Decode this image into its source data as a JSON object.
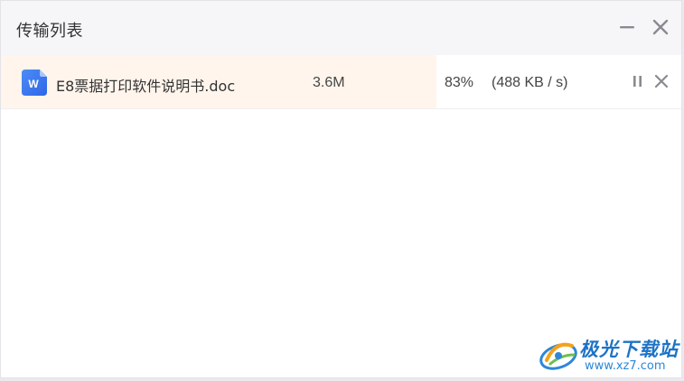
{
  "window": {
    "title": "传输列表"
  },
  "transfers": [
    {
      "icon": "wps-word-document-icon",
      "icon_letter": "W",
      "file_name": "E8票据打印软件说明书.doc",
      "size": "3.6M",
      "percent_label": "83%",
      "progress": 0.64,
      "speed": "(488 KB / s)"
    }
  ],
  "watermark": {
    "name": "极光下载站",
    "url": "www.xz7.com"
  },
  "colors": {
    "titlebar_bg": "#f6f6f9",
    "progress_fill": "#fff5ec",
    "icon_blue": "#3f7cf6",
    "watermark_blue": "#1e73c6"
  }
}
